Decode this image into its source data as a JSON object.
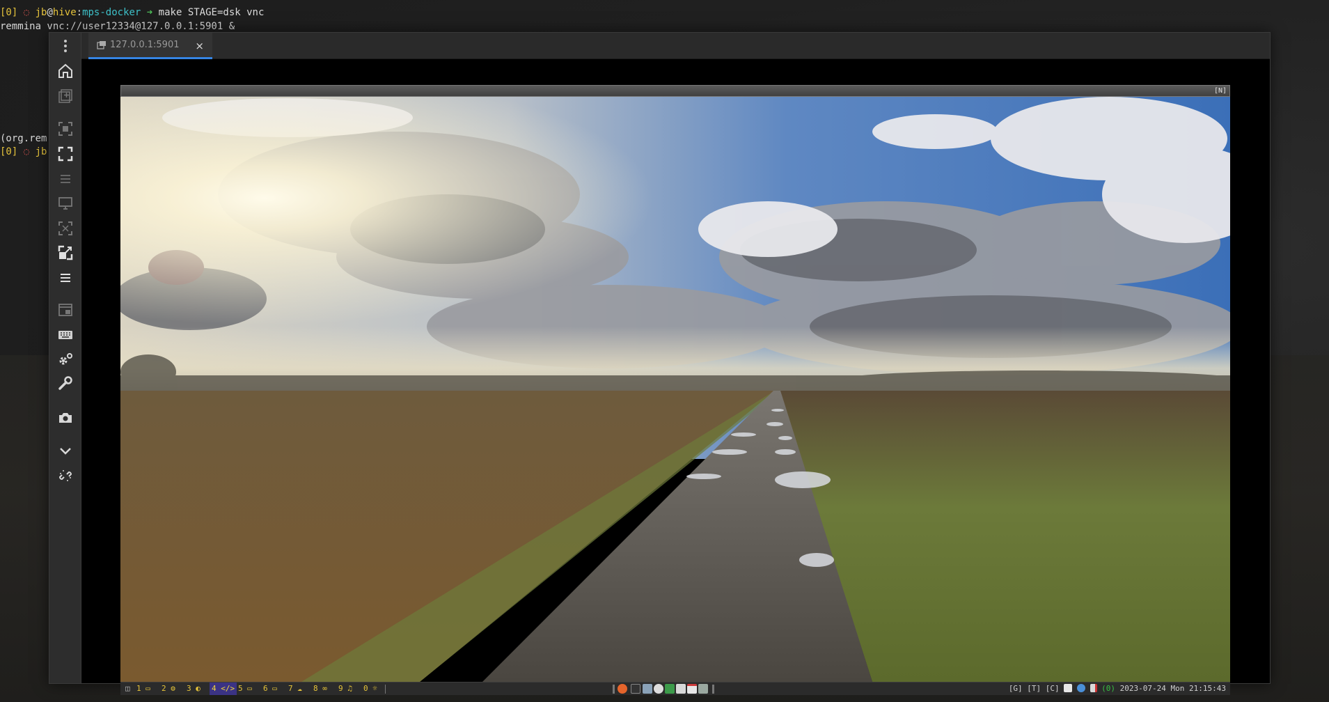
{
  "terminal": {
    "line1": {
      "tag": "[0]",
      "prompt_user": "jb",
      "prompt_at": "@",
      "prompt_host": "hive",
      "prompt_colon": ":",
      "prompt_dir": "mps-docker",
      "arrow": "➜",
      "command": "make STAGE=dsk vnc"
    },
    "line2": "remmina vnc://user12334@127.0.0.1:5901 &",
    "line3": "(org.rem",
    "line4": {
      "tag": "[0]",
      "prompt_user": "jb"
    }
  },
  "remmina": {
    "tab": {
      "label": "127.0.0.1:5901",
      "close": "×"
    },
    "toolbar_icons": [
      "menu-icon",
      "home-icon",
      "new-connection-icon",
      "fit-window-icon",
      "fullscreen-icon",
      "multi-monitor-icon",
      "dynamic-resolution-icon",
      "scaled-mode-icon",
      "scale-icon",
      "toolbar-menu-icon",
      "switch-tab-icon",
      "keyboard-icon",
      "preferences-icon",
      "tools-icon",
      "screenshot-icon",
      "minimize-icon",
      "disconnect-icon"
    ]
  },
  "remote_desktop": {
    "window_flag": "[N]",
    "workspaces": [
      {
        "num": "1",
        "glyph": "▭"
      },
      {
        "num": "2",
        "glyph": "⚙"
      },
      {
        "num": "3",
        "glyph": "◐"
      },
      {
        "num": "4",
        "glyph": "</>"
      },
      {
        "num": "5",
        "glyph": "▭"
      },
      {
        "num": "6",
        "glyph": "▭"
      },
      {
        "num": "7",
        "glyph": "☁"
      },
      {
        "num": "8",
        "glyph": "∞"
      },
      {
        "num": "9",
        "glyph": "♫"
      },
      {
        "num": "0",
        "glyph": "☼"
      }
    ],
    "active_workspace": "4",
    "status_flags": "[G] [T] [C]",
    "status_num": "(0)",
    "datetime": "2023-07-24 Mon 21:15:43",
    "colors": {
      "active_workspace_bg": "#3b3384",
      "workspace_fg": "#e6c43a",
      "tab_accent": "#3584e4"
    }
  }
}
